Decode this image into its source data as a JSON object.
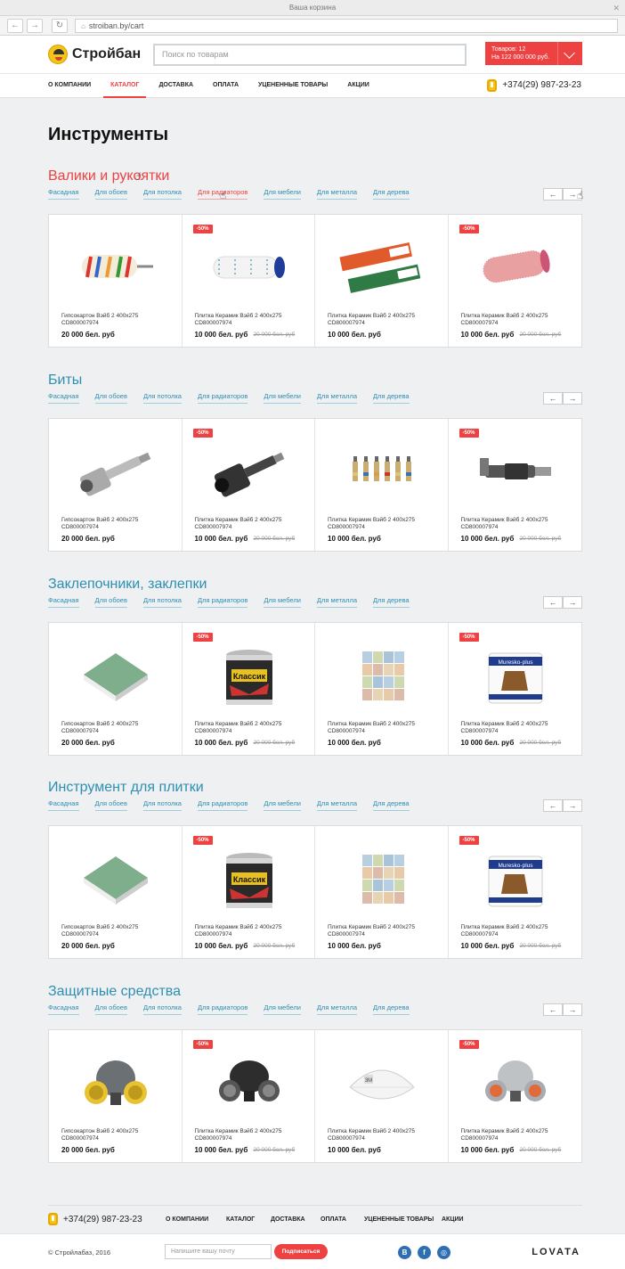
{
  "browser": {
    "window_title": "Ваша корзина",
    "url": "stroiban.by/cart",
    "close": "✕"
  },
  "header": {
    "logo": "Стройбан",
    "search_placeholder": "Поиск по товарам",
    "cart_line1": "Товаров: 12",
    "cart_line2": "На 122 000 000 руб."
  },
  "nav": {
    "items": [
      "О КОМПАНИИ",
      "КАТАЛОГ",
      "ДОСТАВКА",
      "ОПЛАТА",
      "УЦЕНЕННЫЕ ТОВАРЫ",
      "АКЦИИ"
    ],
    "active_index": 1,
    "phone": "+374(29) 987-23-23"
  },
  "page_title": "Инструменты",
  "subcategories": [
    "Фасадная",
    "Для обоев",
    "Для потолка",
    "Для радиаторов",
    "Для мебели",
    "Для металла",
    "Для дерева"
  ],
  "sections": [
    {
      "title": "Валики и рукоятки",
      "highlight": true,
      "products": [
        {
          "badge": "",
          "name": "Гипсокартон Вэйб 2 400х275",
          "code": "CD800007974",
          "price": "20 000 бел. руб",
          "old_price": "",
          "icon": "paint-roller-multicolor"
        },
        {
          "badge": "-50%",
          "name": "Плитка Керамик Вэйб 2 400х275",
          "code": "CD800007974",
          "price": "10 000 бел. руб",
          "old_price": "20 000 бел. руб",
          "icon": "paint-roller-white"
        },
        {
          "badge": "",
          "name": "Плитка Керамик Вэйб 2 400х275",
          "code": "CD800007974",
          "price": "10 000 бел. руб",
          "old_price": "",
          "icon": "mop-pads"
        },
        {
          "badge": "-50%",
          "name": "Плитка Керамик Вэйб 2 400х275",
          "code": "CD800007974",
          "price": "10 000 бел. руб",
          "old_price": "20 000 бел. руб",
          "icon": "paint-roller-pink"
        }
      ]
    },
    {
      "title": "Биты",
      "highlight": false,
      "products": [
        {
          "badge": "",
          "name": "Гипсокартон Вэйб 2 400х275",
          "code": "CD800007974",
          "price": "20 000 бел. руб",
          "old_price": "",
          "icon": "socket-bit-silver"
        },
        {
          "badge": "-50%",
          "name": "Плитка Керамик Вэйб 2 400х275",
          "code": "CD800007974",
          "price": "10 000 бел. руб",
          "old_price": "20 000 бел. руб",
          "icon": "socket-bit-black"
        },
        {
          "badge": "",
          "name": "Плитка Керамик Вэйб 2 400х275",
          "code": "CD800007974",
          "price": "10 000 бел. руб",
          "old_price": "",
          "icon": "bit-set"
        },
        {
          "badge": "-50%",
          "name": "Плитка Керамик Вэйб 2 400х275",
          "code": "CD800007974",
          "price": "10 000 бел. руб",
          "old_price": "20 000 бел. руб",
          "icon": "angle-adapter"
        }
      ]
    },
    {
      "title": "Заклепочники, заклепки",
      "highlight": false,
      "products": [
        {
          "badge": "",
          "name": "Гипсокартон Вэйб 2 400х275",
          "code": "CD800007974",
          "price": "20 000 бел. руб",
          "old_price": "",
          "icon": "drywall-board"
        },
        {
          "badge": "-50%",
          "name": "Плитка Керамик Вэйб 2 400х275",
          "code": "CD800007974",
          "price": "10 000 бел. руб",
          "old_price": "20 000 бел. руб",
          "icon": "paint-can"
        },
        {
          "badge": "",
          "name": "Плитка Керамик Вэйб 2 400х275",
          "code": "CD800007974",
          "price": "10 000 бел. руб",
          "old_price": "",
          "icon": "tiles"
        },
        {
          "badge": "-50%",
          "name": "Плитка Керамик Вэйб 2 400х275",
          "code": "CD800007974",
          "price": "10 000 бел. руб",
          "old_price": "20 000 бел. руб",
          "icon": "paint-bucket"
        }
      ]
    },
    {
      "title": "Инструмент для плитки",
      "highlight": false,
      "products": [
        {
          "badge": "",
          "name": "Гипсокартон Вэйб 2 400х275",
          "code": "CD800007974",
          "price": "20 000 бел. руб",
          "old_price": "",
          "icon": "drywall-board"
        },
        {
          "badge": "-50%",
          "name": "Плитка Керамик Вэйб 2 400х275",
          "code": "CD800007974",
          "price": "10 000 бел. руб",
          "old_price": "20 000 бел. руб",
          "icon": "paint-can"
        },
        {
          "badge": "",
          "name": "Плитка Керамик Вэйб 2 400х275",
          "code": "CD800007974",
          "price": "10 000 бел. руб",
          "old_price": "",
          "icon": "tiles"
        },
        {
          "badge": "-50%",
          "name": "Плитка Керамик Вэйб 2 400х275",
          "code": "CD800007974",
          "price": "10 000 бел. руб",
          "old_price": "20 000 бел. руб",
          "icon": "paint-bucket"
        }
      ]
    },
    {
      "title": "Защитные средства",
      "highlight": false,
      "products": [
        {
          "badge": "",
          "name": "Гипсокартон Вэйб 2 400х275",
          "code": "CD800007974",
          "price": "20 000 бел. руб",
          "old_price": "",
          "icon": "respirator-yellow"
        },
        {
          "badge": "-50%",
          "name": "Плитка Керамик Вэйб 2 400х275",
          "code": "CD800007974",
          "price": "10 000 бел. руб",
          "old_price": "20 000 бел. руб",
          "icon": "respirator-black"
        },
        {
          "badge": "",
          "name": "Плитка Керамик Вэйб 2 400х275",
          "code": "CD800007974",
          "price": "10 000 бел. руб",
          "old_price": "",
          "icon": "dust-mask"
        },
        {
          "badge": "-50%",
          "name": "Плитка Керамик Вэйб 2 400х275",
          "code": "CD800007974",
          "price": "10 000 бел. руб",
          "old_price": "20 000 бел. руб",
          "icon": "respirator-gray"
        }
      ]
    }
  ],
  "footer": {
    "phone": "+374(29) 987-23-23",
    "nav": [
      "О КОМПАНИИ",
      "КАТАЛОГ",
      "ДОСТАВКА",
      "ОПЛАТА",
      "УЦЕНЕННЫЕ ТОВАРЫ",
      "АКЦИИ"
    ],
    "copyright": "© Стройлабаз, 2016",
    "email_placeholder": "Напишите вашу почту",
    "subscribe": "Подписаться",
    "social": [
      "В",
      "f",
      "◎"
    ],
    "brand": "LOVATA"
  },
  "colors": {
    "accent": "#ee4242",
    "link": "#2e8fb3",
    "badge": "#ee4242"
  }
}
